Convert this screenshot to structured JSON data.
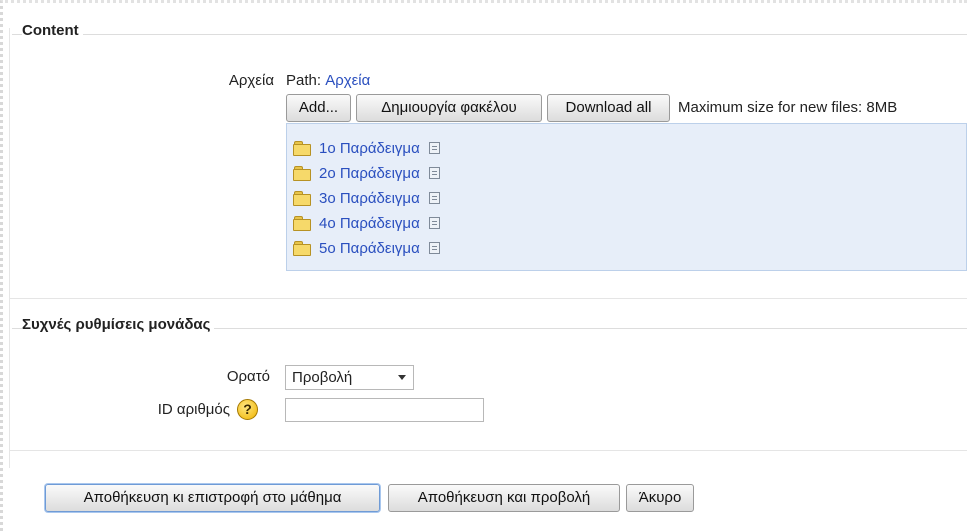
{
  "content_section": {
    "heading": "Content",
    "files_label": "Αρχεία",
    "path_prefix": "Path:",
    "path_link": "Αρχεία",
    "buttons": {
      "add": "Add...",
      "create_folder": "Δημιουργία φακέλου",
      "download_all": "Download all"
    },
    "max_size_text": "Maximum size for new files: 8MB",
    "folders": [
      {
        "name": "1ο Παράδειγμα",
        "icon": "folder-icon"
      },
      {
        "name": "2ο Παράδειγμα",
        "icon": "folder-icon"
      },
      {
        "name": "3ο Παράδειγμα",
        "icon": "folder-icon"
      },
      {
        "name": "4ο Παράδειγμα",
        "icon": "folder-icon"
      },
      {
        "name": "5ο Παράδειγμα",
        "icon": "folder-icon"
      }
    ]
  },
  "common_settings": {
    "heading": "Συχνές ρυθμίσεις μονάδας",
    "visible_label": "Ορατό",
    "visible_value": "Προβολή",
    "id_label": "ID αριθμός",
    "id_value": "",
    "help_symbol": "?"
  },
  "footer_buttons": {
    "save_return": "Αποθήκευση κι επιστροφή στο μάθημα",
    "save_display": "Αποθήκευση και προβολή",
    "cancel": "Άκυρο"
  },
  "colors": {
    "link": "#2a4fbf",
    "filemanager_bg": "#e7eef9",
    "help_icon": "#f0b400"
  }
}
